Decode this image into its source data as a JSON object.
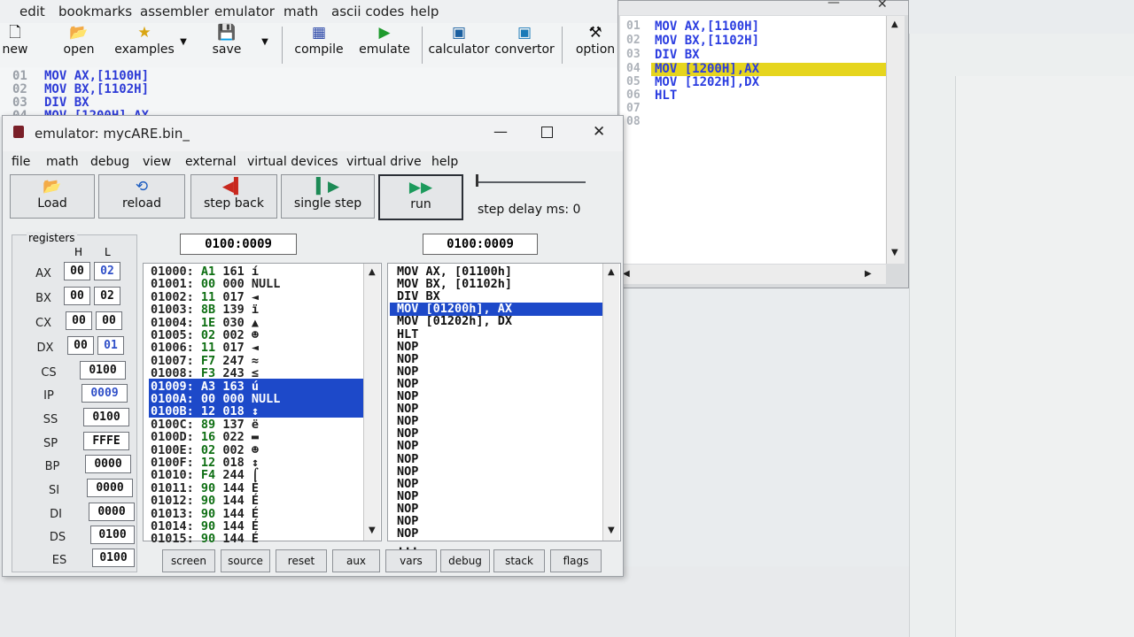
{
  "ide": {
    "menu": [
      "edit",
      "bookmarks",
      "assembler",
      "emulator",
      "math",
      "ascii codes",
      "help"
    ],
    "toolbar": {
      "new": "new",
      "open": "open",
      "examples": "examples",
      "save": "save",
      "compile": "compile",
      "emulate": "emulate",
      "calculator": "calculator",
      "convertor": "convertor",
      "options": "option"
    },
    "editor_lines": [
      {
        "num": "01",
        "code": "MOV AX,[1100H]"
      },
      {
        "num": "02",
        "code": "MOV BX,[1102H]"
      },
      {
        "num": "03",
        "code": "DIV BX"
      },
      {
        "num": "04",
        "code": "MOV [1200H],AX"
      }
    ]
  },
  "source_window": {
    "lines": [
      {
        "num": "01",
        "code": "MOV AX,[1100H]"
      },
      {
        "num": "02",
        "code": "MOV BX,[1102H]"
      },
      {
        "num": "03",
        "code": "DIV BX"
      },
      {
        "num": "04",
        "code": "MOV [1200H],AX"
      },
      {
        "num": "05",
        "code": "MOV [1202H],DX"
      },
      {
        "num": "06",
        "code": "HLT"
      },
      {
        "num": "07",
        "code": ""
      },
      {
        "num": "08",
        "code": ""
      }
    ],
    "highlight_color": "#e6d51e"
  },
  "emulator": {
    "title": "emulator: mycARE.bin_",
    "menu": [
      "file",
      "math",
      "debug",
      "view",
      "external",
      "virtual devices",
      "virtual drive",
      "help"
    ],
    "buttons": {
      "load": "Load",
      "reload": "reload",
      "step_back": "step back",
      "single_step": "single step",
      "run": "run"
    },
    "step_delay": "step delay ms: 0",
    "registers_label": "registers",
    "h_label": "H",
    "l_label": "L",
    "gp_registers": [
      {
        "name": "AX",
        "h": "00",
        "l": "02"
      },
      {
        "name": "BX",
        "h": "00",
        "l": "02"
      },
      {
        "name": "CX",
        "h": "00",
        "l": "00"
      },
      {
        "name": "DX",
        "h": "00",
        "l": "01"
      }
    ],
    "seg_registers": [
      {
        "name": "CS",
        "value": "0100"
      },
      {
        "name": "IP",
        "value": "0009"
      },
      {
        "name": "SS",
        "value": "0100"
      },
      {
        "name": "SP",
        "value": "FFFE"
      },
      {
        "name": "BP",
        "value": "0000"
      },
      {
        "name": "SI",
        "value": "0000"
      },
      {
        "name": "DI",
        "value": "0000"
      },
      {
        "name": "DS",
        "value": "0100"
      },
      {
        "name": "ES",
        "value": "0100"
      }
    ],
    "memory_address": "0100:0009",
    "disasm_address": "0100:0009",
    "memory": [
      {
        "addr": "01000:",
        "hex": "A1",
        "dec": "161",
        "chr": "í"
      },
      {
        "addr": "01001:",
        "hex": "00",
        "dec": "000",
        "chr": "NULL"
      },
      {
        "addr": "01002:",
        "hex": "11",
        "dec": "017",
        "chr": "◄"
      },
      {
        "addr": "01003:",
        "hex": "8B",
        "dec": "139",
        "chr": "ï"
      },
      {
        "addr": "01004:",
        "hex": "1E",
        "dec": "030",
        "chr": "▲"
      },
      {
        "addr": "01005:",
        "hex": "02",
        "dec": "002",
        "chr": "☻"
      },
      {
        "addr": "01006:",
        "hex": "11",
        "dec": "017",
        "chr": "◄"
      },
      {
        "addr": "01007:",
        "hex": "F7",
        "dec": "247",
        "chr": "≈"
      },
      {
        "addr": "01008:",
        "hex": "F3",
        "dec": "243",
        "chr": "≤"
      },
      {
        "addr": "01009:",
        "hex": "A3",
        "dec": "163",
        "chr": "ú"
      },
      {
        "addr": "0100A:",
        "hex": "00",
        "dec": "000",
        "chr": "NULL"
      },
      {
        "addr": "0100B:",
        "hex": "12",
        "dec": "018",
        "chr": "↕"
      },
      {
        "addr": "0100C:",
        "hex": "89",
        "dec": "137",
        "chr": "ë"
      },
      {
        "addr": "0100D:",
        "hex": "16",
        "dec": "022",
        "chr": "▬"
      },
      {
        "addr": "0100E:",
        "hex": "02",
        "dec": "002",
        "chr": "☻"
      },
      {
        "addr": "0100F:",
        "hex": "12",
        "dec": "018",
        "chr": "↕"
      },
      {
        "addr": "01010:",
        "hex": "F4",
        "dec": "244",
        "chr": "⌠"
      },
      {
        "addr": "01011:",
        "hex": "90",
        "dec": "144",
        "chr": "É"
      },
      {
        "addr": "01012:",
        "hex": "90",
        "dec": "144",
        "chr": "É"
      },
      {
        "addr": "01013:",
        "hex": "90",
        "dec": "144",
        "chr": "É"
      },
      {
        "addr": "01014:",
        "hex": "90",
        "dec": "144",
        "chr": "É"
      },
      {
        "addr": "01015:",
        "hex": "90",
        "dec": "144",
        "chr": "É"
      }
    ],
    "disassembly": [
      "MOV AX, [01100h]",
      "MOV BX, [01102h]",
      "DIV BX",
      "MOV [01200h], AX",
      "MOV [01202h], DX",
      "HLT",
      "NOP",
      "NOP",
      "NOP",
      "NOP",
      "NOP",
      "NOP",
      "NOP",
      "NOP",
      "NOP",
      "NOP",
      "NOP",
      "NOP",
      "NOP",
      "NOP",
      "NOP",
      "NOP",
      "..."
    ],
    "bottom_buttons": [
      "screen",
      "source",
      "reset",
      "aux",
      "vars",
      "debug",
      "stack",
      "flags"
    ],
    "selection_color": "#1d49c9"
  }
}
